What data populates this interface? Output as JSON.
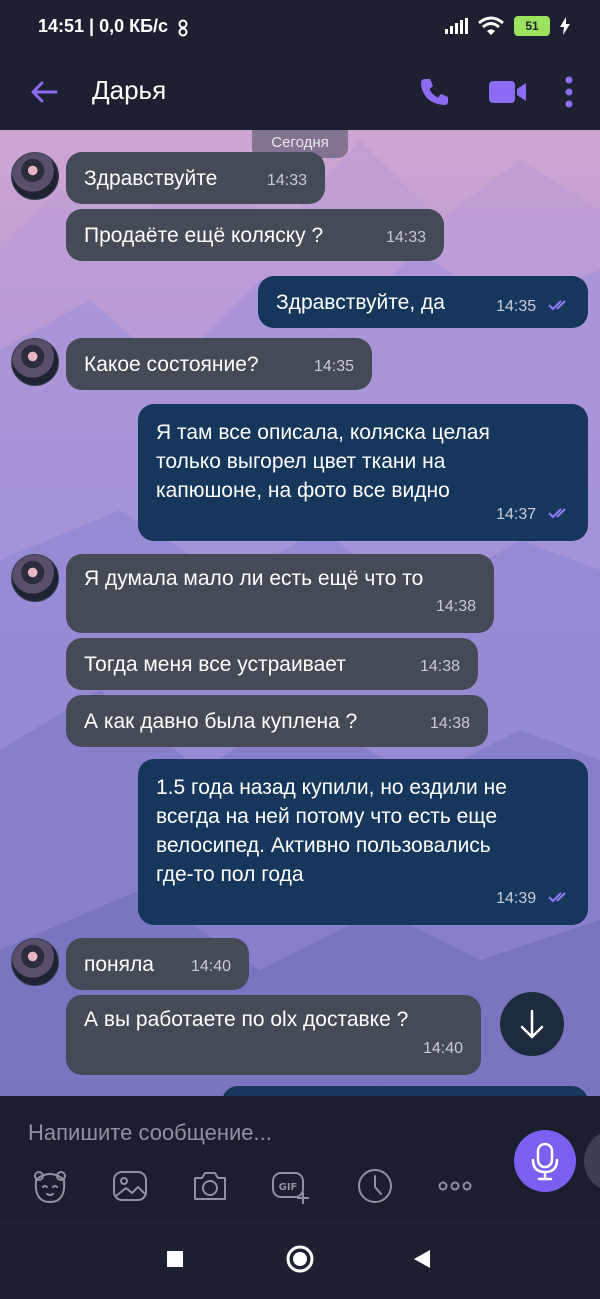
{
  "status_bar": {
    "time": "14:51 | 0,0 КБ/с",
    "battery": "51",
    "icons": [
      "stop-sign-icon",
      "signal-icon",
      "wifi-icon",
      "battery-icon",
      "charging-icon"
    ]
  },
  "header": {
    "contact_name": "Дарья",
    "icons": [
      "back-arrow-icon",
      "phone-icon",
      "video-icon",
      "more-vert-icon"
    ],
    "accent": "#8c6cf2"
  },
  "chat": {
    "date_label": "Сегодня",
    "messages": [
      {
        "dir": "in",
        "text": "Здравствуйте",
        "time": "14:33"
      },
      {
        "dir": "in",
        "text": "Продаёте ещё коляску ?",
        "time": "14:33"
      },
      {
        "dir": "out",
        "text": "Здравствуйте, да",
        "time": "14:35"
      },
      {
        "dir": "in",
        "text": "Какое состояние?",
        "time": "14:35"
      },
      {
        "dir": "out",
        "text": "Я там все описала, коляска целая\nтолько выгорел цвет ткани на\nкапюшоне, на фото все видно",
        "time": "14:37"
      },
      {
        "dir": "in",
        "text": "Я думала мало ли есть ещё что то",
        "time": "14:38"
      },
      {
        "dir": "in",
        "text": "Тогда меня все устраивает",
        "time": "14:38"
      },
      {
        "dir": "in",
        "text": "А как давно была куплена ?",
        "time": "14:38"
      },
      {
        "dir": "out",
        "text": "1.5 года назад купили, но ездили не\nвсегда на ней потому что есть еще\nвелосипед. Активно пользовались\nгде-то пол года",
        "time": "14:39"
      },
      {
        "dir": "in",
        "text": "поняла",
        "time": "14:40"
      },
      {
        "dir": "in",
        "text": "А вы работаете по olx доставке ?",
        "time": "14:40"
      }
    ],
    "colors": {
      "incoming": "#454a57",
      "outgoing": "#17365b",
      "read_ticks": "#8c7cf5"
    }
  },
  "composer": {
    "placeholder": "Напишите сообщение...",
    "toolbar_icons": [
      "sticker-icon",
      "gallery-icon",
      "camera-icon",
      "gif-icon",
      "timer-icon",
      "more-horiz-icon"
    ],
    "mic_color": "#7a5ff0"
  },
  "nav_bar": {
    "icons": [
      "recents-square-icon",
      "home-circle-icon",
      "back-triangle-icon"
    ]
  }
}
